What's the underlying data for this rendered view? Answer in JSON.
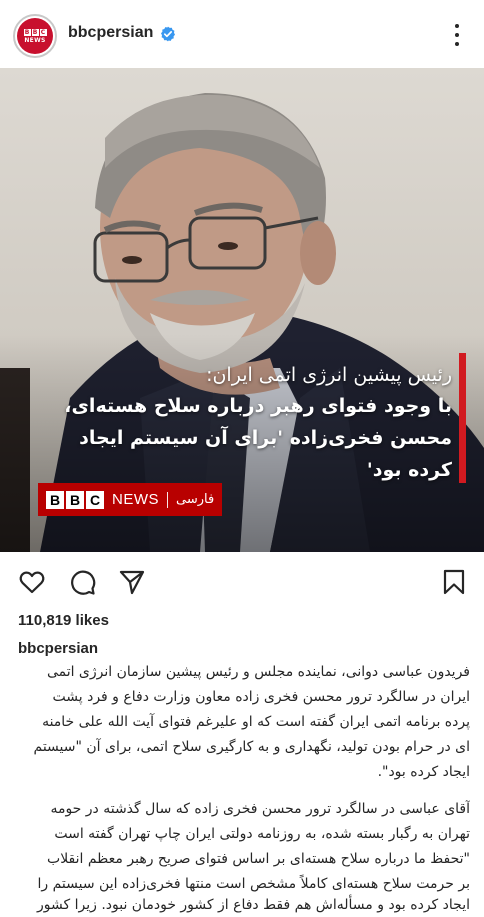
{
  "header": {
    "username": "bbcpersian",
    "avatar_text_top": [
      "B",
      "B",
      "C"
    ],
    "avatar_text_bottom": "NEWS",
    "verified_icon": "verified-badge-icon",
    "more_icon": "more-options-icon",
    "verified_color": "#3897f0"
  },
  "post": {
    "overlay": {
      "line1": "رئیس پیشین انرژی اتمی ایران:",
      "line2": "با وجود فتوای رهبر درباره سلاح هسته‌ای،",
      "line3": "محسن فخری‌زاده 'برای آن سیستم ایجاد",
      "line4": "کرده بود'"
    },
    "brand": {
      "bbc": [
        "B",
        "B",
        "C"
      ],
      "news": "NEWS",
      "language": "فارسی"
    },
    "accent_color": "#d11a20"
  },
  "actions": {
    "like_icon": "heart-icon",
    "comment_icon": "comment-icon",
    "share_icon": "share-icon",
    "save_icon": "bookmark-icon"
  },
  "likes": "110,819 likes",
  "caption": {
    "username": "bbcpersian",
    "paragraph1": [
      "فریدون عباسی دوانی، نماینده مجلس و رئیس پیشین سازمان انرژی اتمی",
      "ایران در سالگرد ترور محسن فخری زاده معاون وزارت دفاع و فرد پشت",
      "پرده برنامه اتمی ایران گفته است که او علیرغم فتوای آیت الله علی خامنه",
      "ای در حرام بودن تولید، نگهداری و به کارگیری سلاح اتمی، برای آن \"سیستم",
      "ایجاد کرده بود\"."
    ],
    "paragraph2": [
      "آقای عباسی در سالگرد ترور محسن فخری زاده که سال گذشته در حومه",
      "تهران به رگبار بسته شده، به روزنامه دولتی ایران چاپ تهران گفته است",
      "\"تحفظ ما درباره سلاح هسته‌ای بر اساس فتوای صریح رهبر معظم انقلاب",
      "بر حرمت سلاح هسته‌ای کاملاً مشخص است منتها فخری‌زاده این سیستم را",
      "ایجاد کرده بود و مسأله‌اش هم فقط دفاع از کشور خودمان نبود. زیرا کشور"
    ]
  }
}
